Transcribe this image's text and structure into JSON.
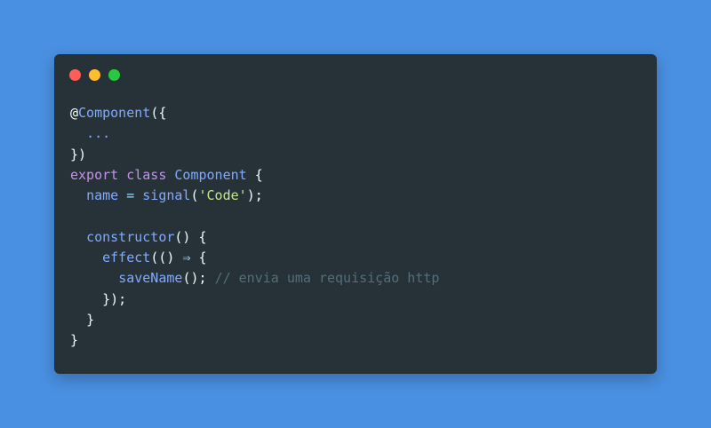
{
  "colors": {
    "background": "#4a90e2",
    "window": "#263238",
    "close": "#ff5f57",
    "minimize": "#febc2e",
    "maximize": "#28c840"
  },
  "window_controls": [
    {
      "name": "close",
      "icon": "close-dot-icon"
    },
    {
      "name": "minimize",
      "icon": "minimize-dot-icon"
    },
    {
      "name": "maximize",
      "icon": "maximize-dot-icon"
    }
  ],
  "code_lines": [
    [
      {
        "t": "@",
        "c": "decorator"
      },
      {
        "t": "Component",
        "c": "function"
      },
      {
        "t": "({",
        "c": "punct"
      }
    ],
    [
      {
        "t": "  ",
        "c": "plain"
      },
      {
        "t": "...",
        "c": "ellipsis"
      }
    ],
    [
      {
        "t": "})",
        "c": "punct"
      }
    ],
    [
      {
        "t": "export",
        "c": "keyword"
      },
      {
        "t": " ",
        "c": "plain"
      },
      {
        "t": "class",
        "c": "keyword"
      },
      {
        "t": " ",
        "c": "plain"
      },
      {
        "t": "Component",
        "c": "class"
      },
      {
        "t": " {",
        "c": "punct"
      }
    ],
    [
      {
        "t": "  ",
        "c": "plain"
      },
      {
        "t": "name",
        "c": "property"
      },
      {
        "t": " ",
        "c": "plain"
      },
      {
        "t": "=",
        "c": "operator"
      },
      {
        "t": " ",
        "c": "plain"
      },
      {
        "t": "signal",
        "c": "function"
      },
      {
        "t": "(",
        "c": "punct"
      },
      {
        "t": "'Code'",
        "c": "string"
      },
      {
        "t": ");",
        "c": "punct"
      }
    ],
    [],
    [
      {
        "t": "  ",
        "c": "plain"
      },
      {
        "t": "constructor",
        "c": "function"
      },
      {
        "t": "() {",
        "c": "punct"
      }
    ],
    [
      {
        "t": "    ",
        "c": "plain"
      },
      {
        "t": "effect",
        "c": "function"
      },
      {
        "t": "(() ",
        "c": "punct"
      },
      {
        "t": "⇒",
        "c": "operator"
      },
      {
        "t": " {",
        "c": "punct"
      }
    ],
    [
      {
        "t": "      ",
        "c": "plain"
      },
      {
        "t": "saveName",
        "c": "function"
      },
      {
        "t": "(); ",
        "c": "punct"
      },
      {
        "t": "// envia uma requisição http",
        "c": "comment"
      }
    ],
    [
      {
        "t": "    ",
        "c": "plain"
      },
      {
        "t": "});",
        "c": "punct"
      }
    ],
    [
      {
        "t": "  ",
        "c": "plain"
      },
      {
        "t": "}",
        "c": "punct"
      }
    ],
    [
      {
        "t": "}",
        "c": "punct"
      }
    ]
  ]
}
